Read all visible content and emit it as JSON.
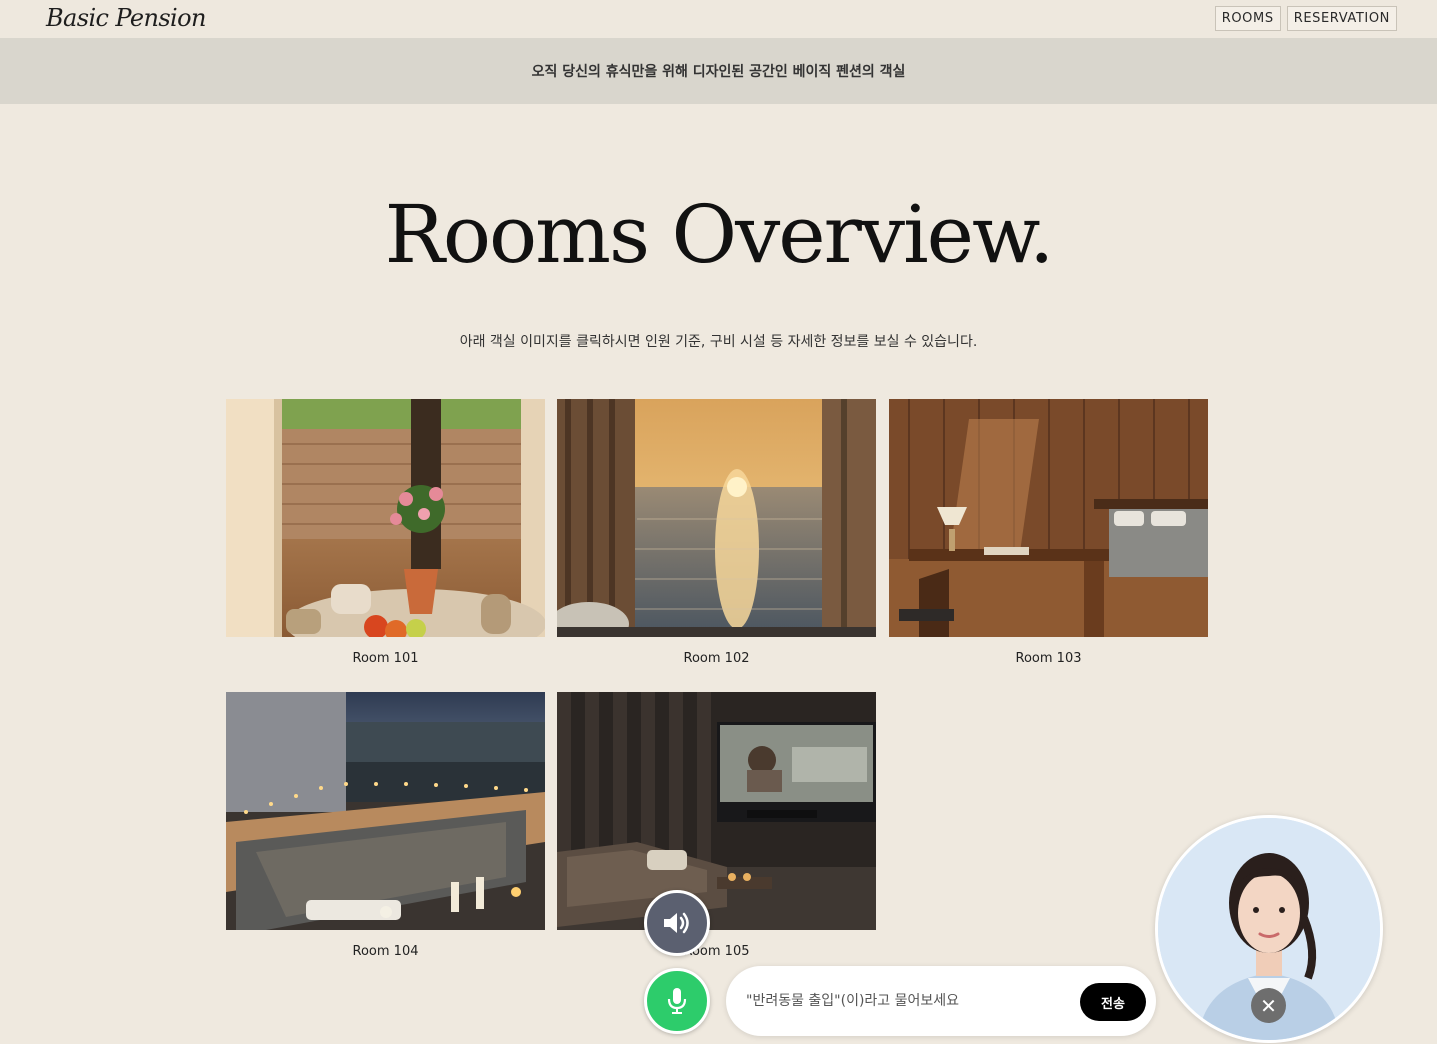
{
  "header": {
    "logo": "Basic Pension",
    "nav": [
      "ROOMS",
      "RESERVATION"
    ]
  },
  "banner": {
    "text": "오직 당신의 휴식만을 위해 디자인된 공간인 베이직 펜션의 객실"
  },
  "main": {
    "title": "Rooms Overview.",
    "subtitle": "아래 객실 이미지를 클릭하시면 인원 기준, 구비 시설 등 자세한 정보를 보실 수 있습니다.",
    "rooms": [
      {
        "label": "Room 101",
        "scene": "sunlit table with flowers and coffee by a deck window"
      },
      {
        "label": "Room 102",
        "scene": "sunset over the sea through curtains"
      },
      {
        "label": "Room 103",
        "scene": "wooden bedroom with desk and lamp"
      },
      {
        "label": "Room 104",
        "scene": "evening outdoor bath with candles and sea view"
      },
      {
        "label": "Room 105",
        "scene": "home theater with projector screen and sofa"
      }
    ]
  },
  "assistant": {
    "speaker_icon": "speaker-icon",
    "mic_icon": "microphone-icon",
    "input_placeholder": "\"반려동물 출입\"(이)라고 물어보세요",
    "send_label": "전송",
    "close_icon": "close-icon",
    "colors": {
      "speaker_bg": "#5b6070",
      "mic_bg": "#2dcc6b",
      "send_bg": "#000000"
    }
  }
}
